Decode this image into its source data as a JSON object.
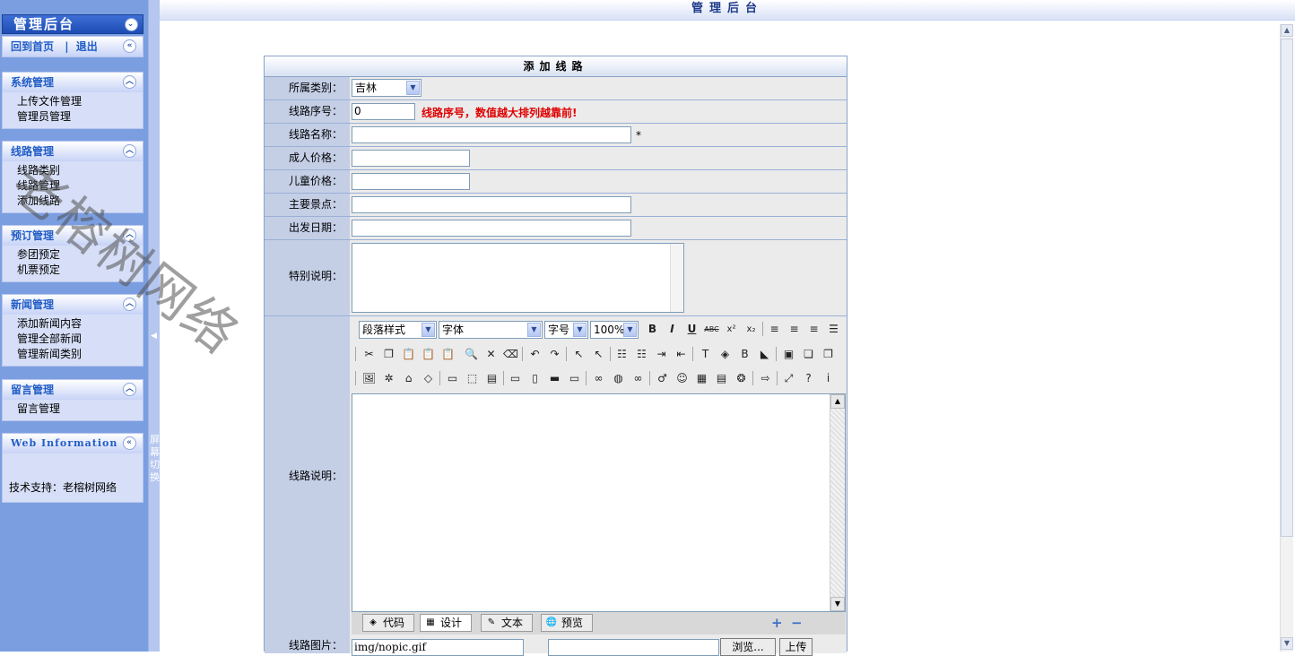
{
  "sidebar": {
    "title": "管理后台",
    "header_toggle": "⌄",
    "links": {
      "home": "回到首页",
      "sep": "|",
      "logout": "退出"
    },
    "panels": [
      {
        "title": "系统管理",
        "items": [
          "上传文件管理",
          "管理员管理"
        ]
      },
      {
        "title": "线路管理",
        "items": [
          "线路类别",
          "线路管理",
          "添加线路"
        ]
      },
      {
        "title": "预订管理",
        "items": [
          "参团预定",
          "机票预定"
        ]
      },
      {
        "title": "新闻管理",
        "items": [
          "添加新闻内容",
          "管理全部新闻",
          "管理新闻类别"
        ]
      },
      {
        "title": "留言管理",
        "items": [
          "留言管理"
        ]
      }
    ],
    "web_info": {
      "title": "Web Information",
      "text": "技术支持：老榕树网络"
    }
  },
  "splitter": {
    "text": "屏幕切换"
  },
  "topbar": {
    "title": "管理后台"
  },
  "form": {
    "title": "添加线路",
    "category": {
      "label": "所属类别：",
      "selected": "吉林"
    },
    "order": {
      "label": "线路序号：",
      "value": "0",
      "hint": "线路序号，数值越大排列越靠前!"
    },
    "name": {
      "label": "线路名称：",
      "value": "",
      "required": "*"
    },
    "adult_price": {
      "label": "成人价格：",
      "value": ""
    },
    "child_price": {
      "label": "儿童价格：",
      "value": ""
    },
    "main_spots": {
      "label": "主要景点：",
      "value": ""
    },
    "depart_date": {
      "label": "出发日期：",
      "value": ""
    },
    "special_note": {
      "label": "特别说明：",
      "value": ""
    },
    "description": {
      "label": "线路说明：",
      "toolbar": {
        "paragraph_style": "段落样式",
        "font": "字体",
        "font_size": "字号",
        "zoom": "100%"
      },
      "modes": [
        "代码",
        "设计",
        "文本",
        "预览"
      ],
      "active_mode": "设计"
    },
    "image": {
      "label": "线路图片：",
      "value": "img/nopic.gif",
      "browse": "浏览...",
      "upload": "上传"
    }
  },
  "watermark": "老榕树网络"
}
